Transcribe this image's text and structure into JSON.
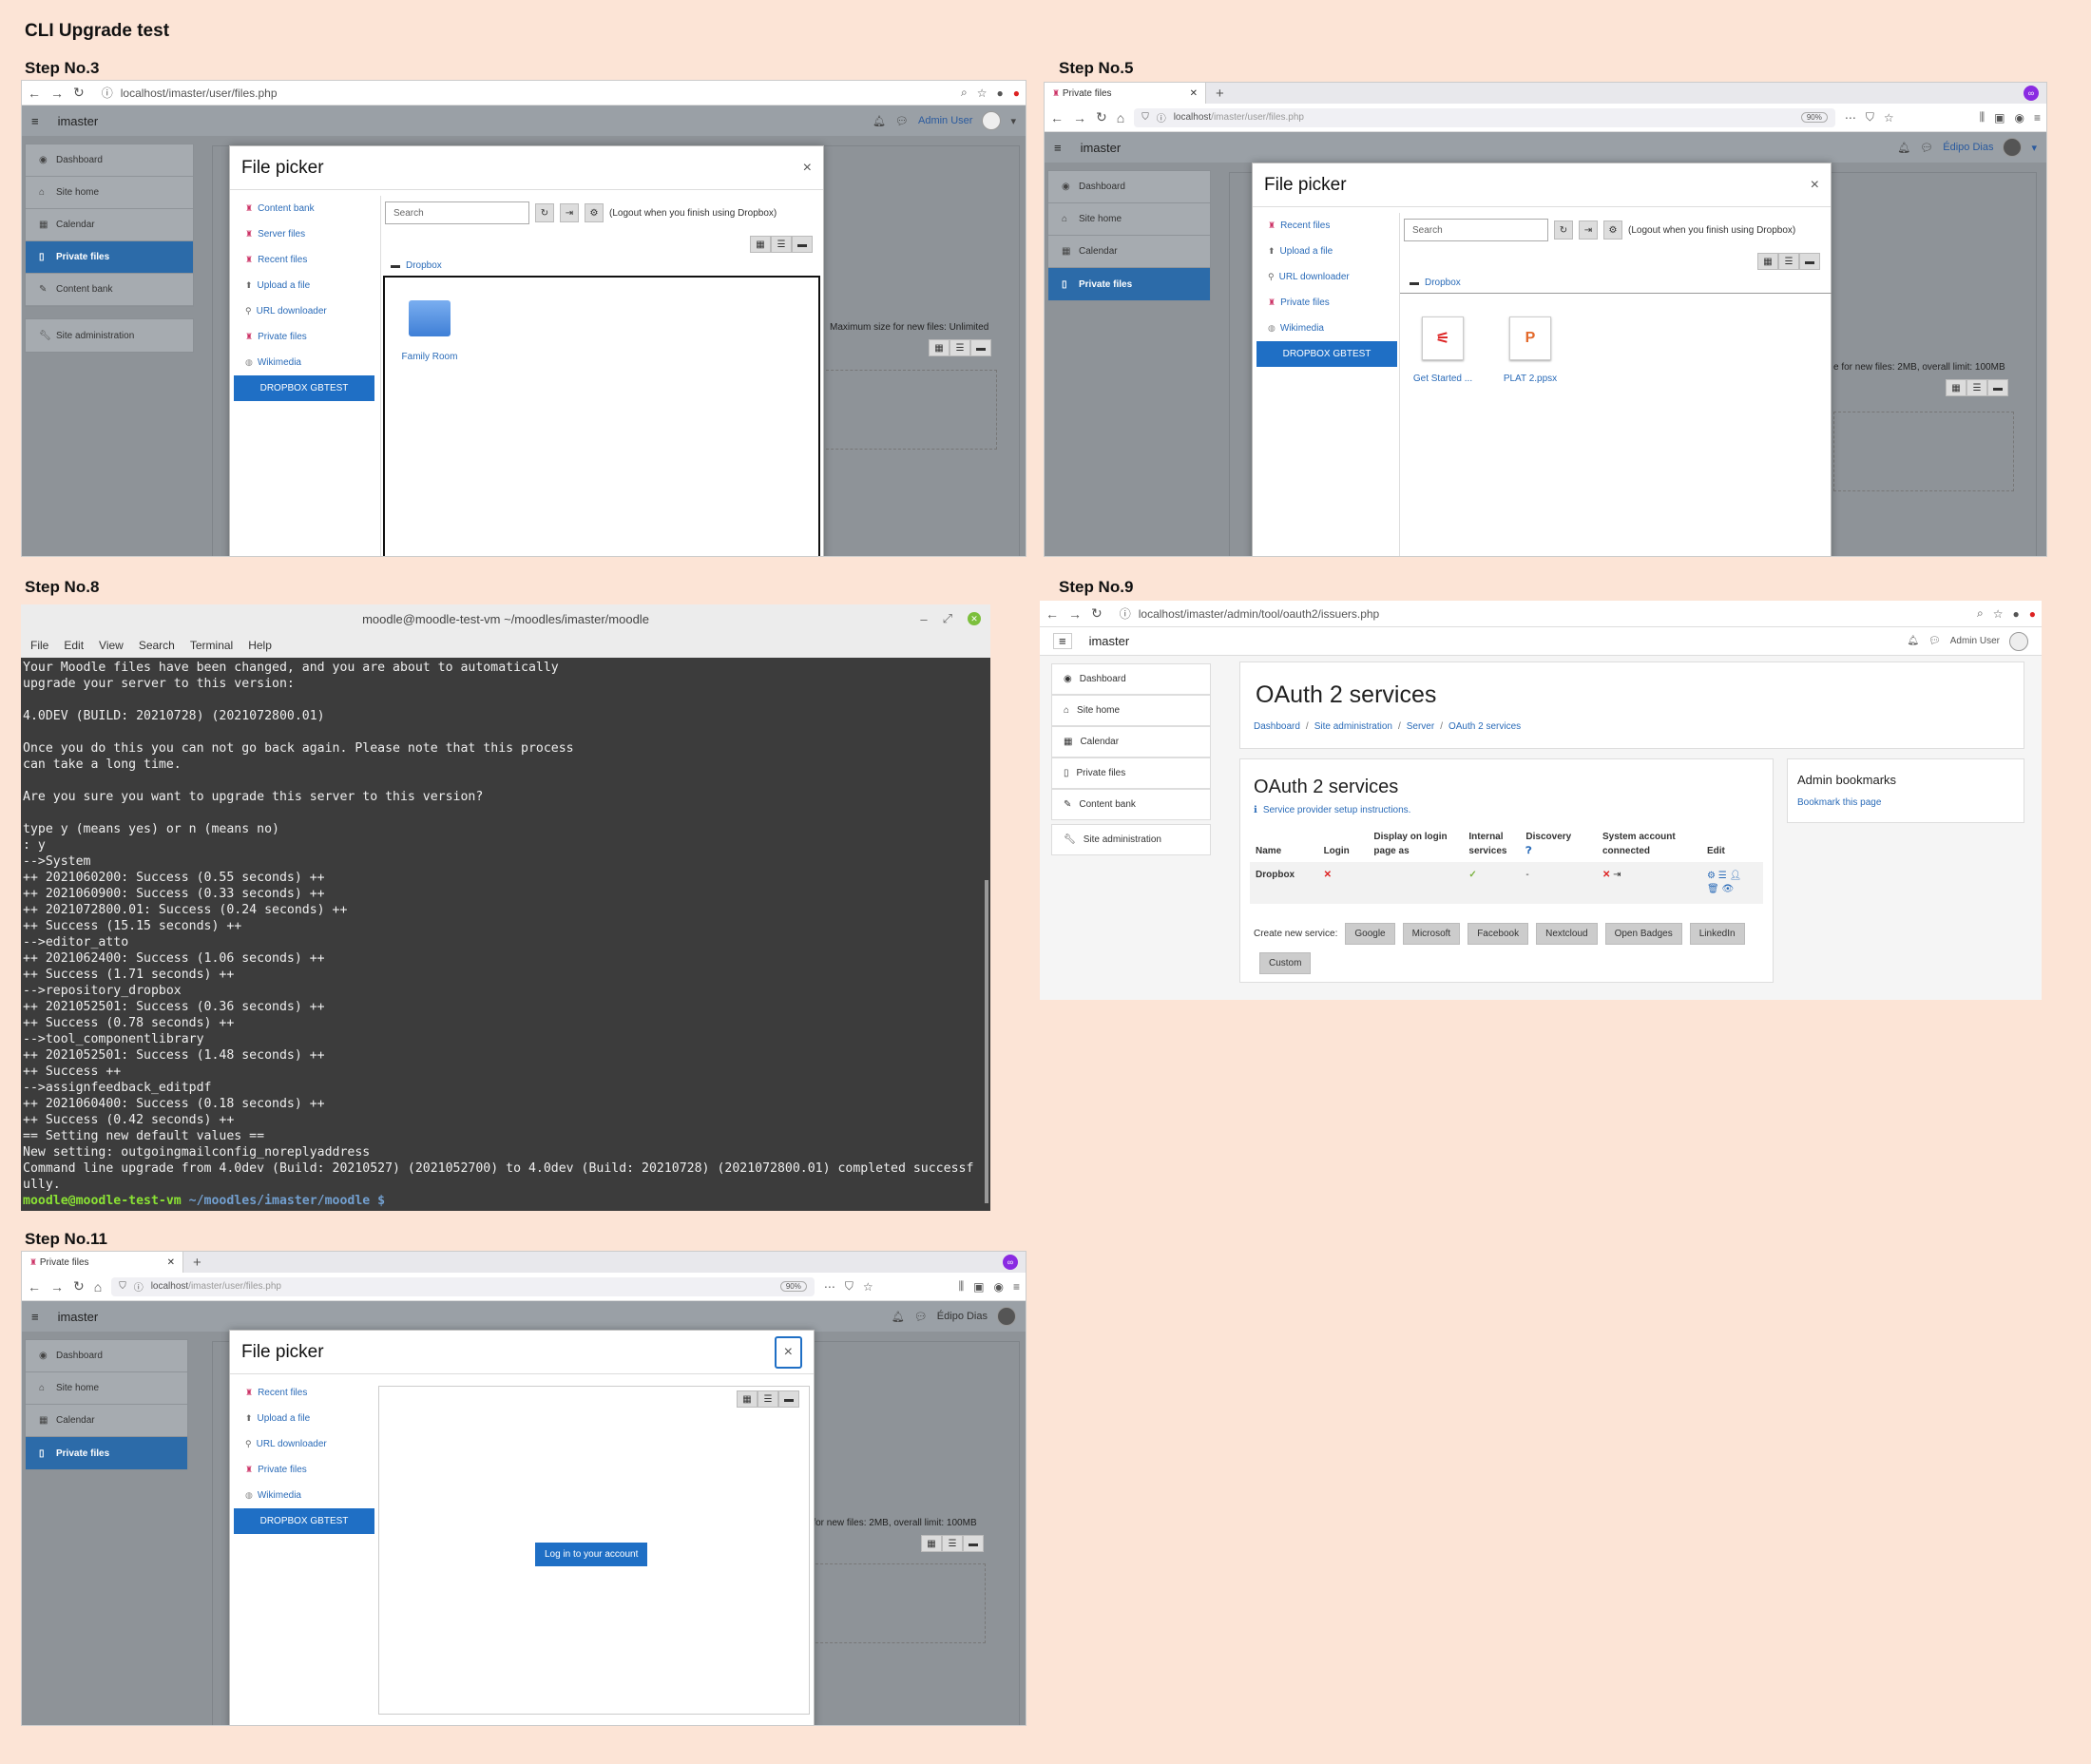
{
  "doc_title": "CLI Upgrade test",
  "steps": {
    "s3": "Step No.3",
    "s5": "Step No.5",
    "s8": "Step No.8",
    "s9": "Step No.9",
    "s11": "Step No.11"
  },
  "common": {
    "site_name": "imaster",
    "admin_user": "Admin User",
    "edipo": "Édipo Dias",
    "tab_label": "Private files",
    "zoom": "90%",
    "url_files_host": "localhost",
    "url_files_path": "/imaster/user/files.php",
    "url_oauth_path": "/imaster/admin/tool/oauth2/issuers.php"
  },
  "sidebar": [
    "Dashboard",
    "Site home",
    "Calendar",
    "Private files",
    "Content bank",
    "Site administration"
  ],
  "picker": {
    "title": "File picker",
    "close": "×",
    "search_placeholder": "Search",
    "logout_note": "(Logout when you finish using Dropbox)",
    "breadcrumb": "Dropbox",
    "repos_step3": [
      "Content bank",
      "Server files",
      "Recent files",
      "Upload a file",
      "URL downloader",
      "Private files",
      "Wikimedia",
      "DROPBOX GBTEST"
    ],
    "repos_step5": [
      "Recent files",
      "Upload a file",
      "URL downloader",
      "Private files",
      "Wikimedia",
      "DROPBOX GBTEST"
    ],
    "folder_step3": "Family Room",
    "files_step5": [
      "Get Started ...",
      "PLAT 2.ppsx"
    ],
    "login_button": "Log in to your account"
  },
  "maxsize": {
    "step3": "Maximum size for new files: Unlimited",
    "step5": "e for new files: 2MB, overall limit: 100MB",
    "step11": "e for new files: 2MB, overall limit: 100MB"
  },
  "terminal": {
    "title": "moodle@moodle-test-vm ~/moodles/imaster/moodle",
    "menu": [
      "File",
      "Edit",
      "View",
      "Search",
      "Terminal",
      "Help"
    ],
    "lines": [
      "Your Moodle files have been changed, and you are about to automatically",
      "upgrade your server to this version:",
      "",
      "4.0DEV (BUILD: 20210728) (2021072800.01)",
      "",
      "Once you do this you can not go back again. Please note that this process",
      "can take a long time.",
      "",
      "Are you sure you want to upgrade this server to this version?",
      "",
      "type y (means yes) or n (means no)",
      ": y",
      "-->System",
      "++ 2021060200: Success (0.55 seconds) ++",
      "++ 2021060900: Success (0.33 seconds) ++",
      "++ 2021072800.01: Success (0.24 seconds) ++",
      "++ Success (15.15 seconds) ++",
      "-->editor_atto",
      "++ 2021062400: Success (1.06 seconds) ++",
      "++ Success (1.71 seconds) ++",
      "-->repository_dropbox",
      "++ 2021052501: Success (0.36 seconds) ++",
      "++ Success (0.78 seconds) ++",
      "-->tool_componentlibrary",
      "++ 2021052501: Success (1.48 seconds) ++",
      "++ Success ++",
      "-->assignfeedback_editpdf",
      "++ 2021060400: Success (0.18 seconds) ++",
      "++ Success (0.42 seconds) ++",
      "== Setting new default values ==",
      "New setting: outgoingmailconfig_noreplyaddress",
      "Command line upgrade from 4.0dev (Build: 20210527) (2021052700) to 4.0dev (Build: 20210728) (2021072800.01) completed successf",
      "ully."
    ],
    "prompt_user": "moodle@moodle-test-vm",
    "prompt_path": " ~/moodles/imaster/moodle $"
  },
  "oauth": {
    "page_title": "OAuth 2 services",
    "breadcrumb": [
      "Dashboard",
      "Site administration",
      "Server",
      "OAuth 2 services"
    ],
    "card_title": "OAuth 2 services",
    "help_link": "Service provider setup instructions.",
    "headers": [
      "Name",
      "Login",
      "Display on login page as",
      "Internal services",
      "Discovery",
      "System account connected",
      "Edit"
    ],
    "row": {
      "name": "Dropbox",
      "login": "✕",
      "display": "",
      "internal": "✓",
      "discovery": "-",
      "system": "✕"
    },
    "create_label": "Create new service:",
    "services": [
      "Google",
      "Microsoft",
      "Facebook",
      "Nextcloud",
      "Open Badges",
      "LinkedIn",
      "Custom"
    ],
    "bookmarks_title": "Admin bookmarks",
    "bookmarks_link": "Bookmark this page"
  },
  "colors": {
    "background": "#fce4d6",
    "accent": "#1f6fc5",
    "selected_nav": "#2c6ba9",
    "terminal_bg": "#3c3c3c"
  }
}
